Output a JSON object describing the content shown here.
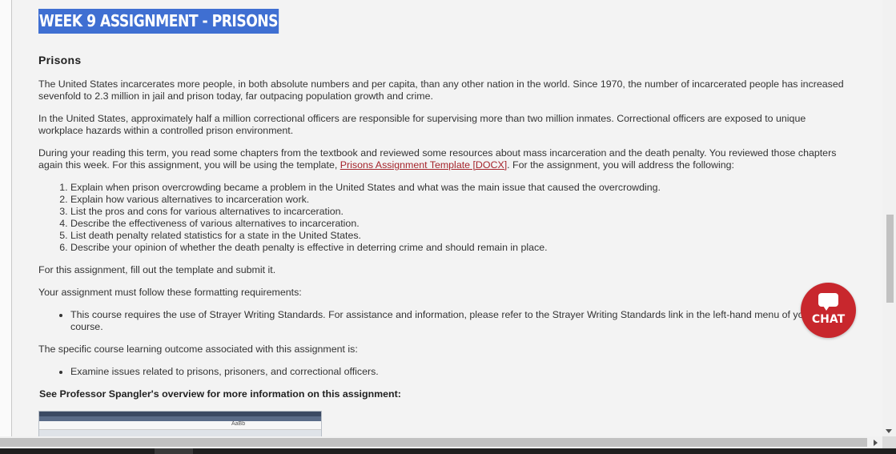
{
  "page": {
    "title": "WEEK 9 ASSIGNMENT - PRISONS",
    "subheading": "Prisons",
    "paragraphs": {
      "p1": "The United States incarcerates more people, in both absolute numbers and per capita, than any other nation in the world. Since 1970, the number of incarcerated people has increased sevenfold to 2.3 million in jail and prison today, far outpacing population growth and crime.",
      "p2": "In the United States, approximately half a million correctional officers are responsible for supervising more than two million inmates. Correctional officers are exposed to unique workplace hazards within a controlled prison environment.",
      "p3_before": "During your reading this term, you read some chapters from the textbook and reviewed some resources about mass incarceration and the death penalty. You reviewed those chapters again this week. For this assignment, you will be using the template, ",
      "p3_link": "Prisons Assignment Template [DOCX]",
      "p3_after": ". For the assignment, you will address the following:",
      "p4": "For this assignment, fill out the template and submit it.",
      "p5": "Your assignment must follow these formatting requirements:",
      "p6": "The specific course learning outcome associated with this assignment is:"
    },
    "tasks": [
      "Explain when prison overcrowding became a problem in the United States and what was the main issue that caused the overcrowding.",
      "Explain how various alternatives to incarceration work.",
      "List the pros and cons for various alternatives to incarceration.",
      "Describe the effectiveness of various alternatives to incarceration.",
      "List death penalty related statistics for a state in the United States.",
      "Describe your opinion of whether the death penalty is effective in deterring crime and should remain in place."
    ],
    "formatting_requirement": "This course requires the use of Strayer Writing Standards. For assistance and information, please refer to the Strayer Writing Standards link in the left-hand menu of your course.",
    "learning_outcome": "Examine issues related to prisons, prisoners, and correctional officers.",
    "overview_heading": "See Professor Spangler's overview for more information on this assignment:",
    "thumbnail_text": "AaBb"
  },
  "chat": {
    "label": "CHAT",
    "color": "#c8272d"
  },
  "colors": {
    "title_highlight": "#3f6fd2",
    "link": "#a5252c"
  }
}
